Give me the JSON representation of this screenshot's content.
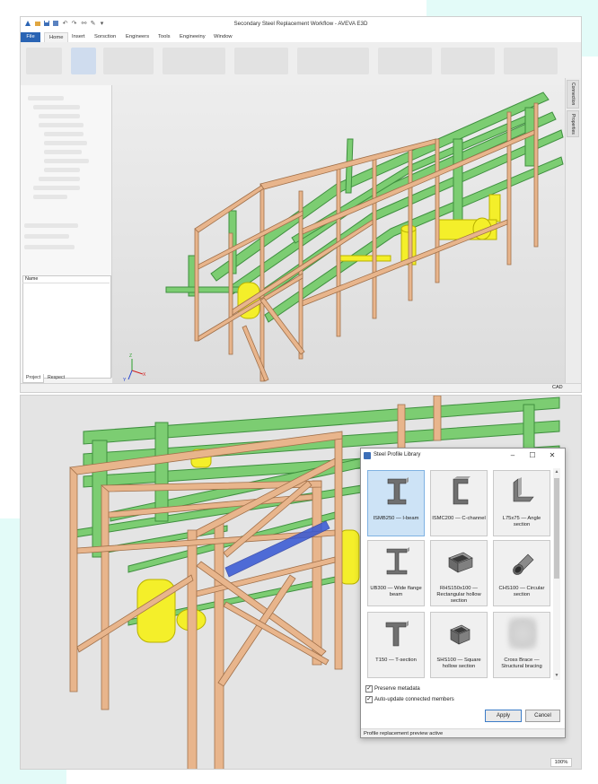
{
  "window": {
    "title": "Secondary Steel Replacement Workflow - AVEVA E3D",
    "status_mode": "CAD",
    "zoom": "100%"
  },
  "ribbon": {
    "tabs": [
      "File",
      "Home",
      "Insert",
      "Sorsction",
      "Engineers",
      "Tools",
      "Engineeiny",
      "Window"
    ],
    "active_tab": "Home"
  },
  "left_panel": {
    "name_header": "Name",
    "tabs": [
      "Project",
      "Respect"
    ]
  },
  "right_panel": {
    "tabs": [
      "Connection",
      "Properties"
    ]
  },
  "dialog": {
    "title": "Steel Profile Library",
    "profiles": [
      {
        "name": "ISMB250 — I-beam",
        "icon": "i-beam-icon",
        "selected": true
      },
      {
        "name": "ISMC200 — C-channel",
        "icon": "c-channel-icon",
        "selected": false
      },
      {
        "name": "L75x75 — Angle section",
        "icon": "angle-section-icon",
        "selected": false
      },
      {
        "name": "UB300 — Wide flange beam",
        "icon": "wide-flange-icon",
        "selected": false
      },
      {
        "name": "RHS150x100 — Rectangular hollow section",
        "icon": "rectangular-hollow-icon",
        "selected": false
      },
      {
        "name": "CHS100 — Circular section",
        "icon": "circular-hollow-icon",
        "selected": false
      },
      {
        "name": "T150 — T-section",
        "icon": "t-section-icon",
        "selected": false
      },
      {
        "name": "SHS100 — Square hollow section",
        "icon": "square-hollow-icon",
        "selected": false
      },
      {
        "name": "Cross Brace — Structural bracing",
        "icon": "cross-brace-icon",
        "selected": false
      }
    ],
    "options": [
      {
        "label": "Preserve metadata",
        "checked": true
      },
      {
        "label": "Auto-update connected members",
        "checked": true
      }
    ],
    "apply_label": "Apply",
    "cancel_label": "Cancel",
    "status": "Profile replacement preview active"
  },
  "colors": {
    "accent": "#2a64b4",
    "steel": "#e8b58c",
    "pipe": "#6fc26f",
    "equipment": "#f4ef2a",
    "highlight": "#3557d4"
  }
}
